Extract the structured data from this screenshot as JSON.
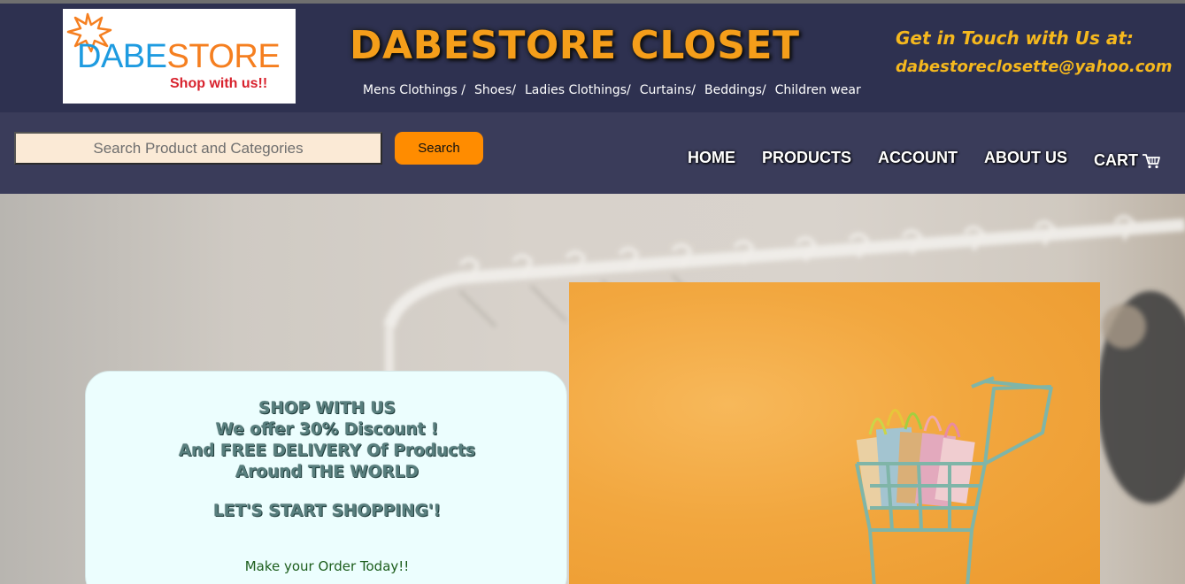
{
  "header": {
    "logo": {
      "brand_part1": "DABE",
      "brand_part2": "STORE",
      "tagline": "Shop with us!!"
    },
    "title": "DABESTORE CLOSET",
    "categories": [
      "Mens Clothings /",
      "Shoes/",
      "Ladies Clothings/",
      "Curtains/",
      "Beddings/",
      "Children wear"
    ],
    "contact_heading": "Get in Touch with Us at:",
    "contact_email": "dabestoreclosette@yahoo.com"
  },
  "navbar": {
    "search_placeholder": "Search Product and Categories",
    "search_button": "Search",
    "links": {
      "home": "HOME",
      "products": "PRODUCTS",
      "account": "ACCOUNT",
      "about": "ABOUT US",
      "cart": "CART"
    },
    "cart_icon": "shopping-cart-icon"
  },
  "hero": {
    "promo_lines": [
      "SHOP WITH US",
      "We offer 30% Discount !",
      "And FREE DELIVERY Of Products",
      "Around THE WORLD",
      "LET'S START SHOPPING'!"
    ],
    "cta": "Make your Order Today!!"
  },
  "colors": {
    "header_bg": "#2e3150",
    "navbar_bg": "#3a3c5a",
    "title_orange": "#f59e1a",
    "contact_yellow": "#f5b81e",
    "search_button": "#ff8c00",
    "promo_card_bg": "#ecfefe"
  }
}
